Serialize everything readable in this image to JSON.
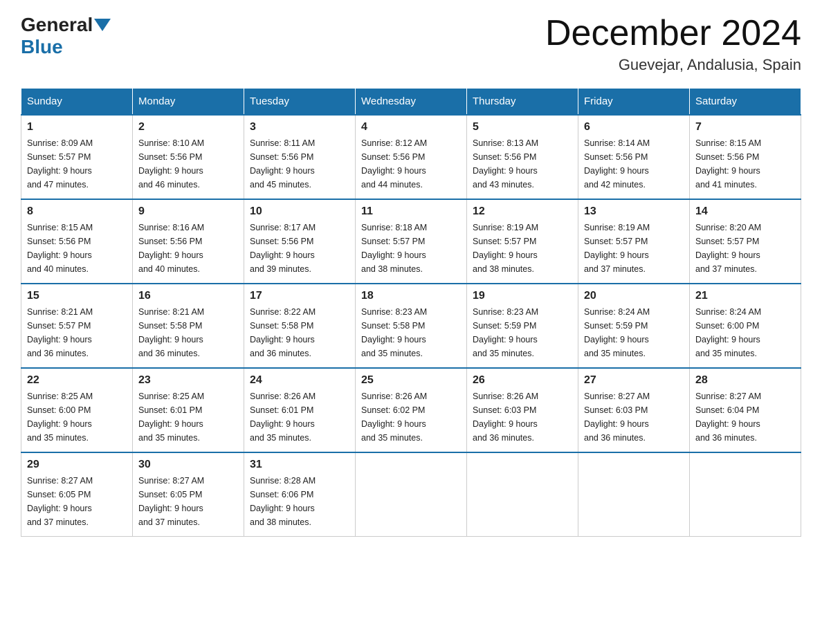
{
  "header": {
    "logo_general": "General",
    "logo_blue": "Blue",
    "month_title": "December 2024",
    "location": "Guevejar, Andalusia, Spain"
  },
  "days_of_week": [
    "Sunday",
    "Monday",
    "Tuesday",
    "Wednesday",
    "Thursday",
    "Friday",
    "Saturday"
  ],
  "weeks": [
    [
      {
        "day": "1",
        "sunrise": "8:09 AM",
        "sunset": "5:57 PM",
        "daylight": "9 hours and 47 minutes."
      },
      {
        "day": "2",
        "sunrise": "8:10 AM",
        "sunset": "5:56 PM",
        "daylight": "9 hours and 46 minutes."
      },
      {
        "day": "3",
        "sunrise": "8:11 AM",
        "sunset": "5:56 PM",
        "daylight": "9 hours and 45 minutes."
      },
      {
        "day": "4",
        "sunrise": "8:12 AM",
        "sunset": "5:56 PM",
        "daylight": "9 hours and 44 minutes."
      },
      {
        "day": "5",
        "sunrise": "8:13 AM",
        "sunset": "5:56 PM",
        "daylight": "9 hours and 43 minutes."
      },
      {
        "day": "6",
        "sunrise": "8:14 AM",
        "sunset": "5:56 PM",
        "daylight": "9 hours and 42 minutes."
      },
      {
        "day": "7",
        "sunrise": "8:15 AM",
        "sunset": "5:56 PM",
        "daylight": "9 hours and 41 minutes."
      }
    ],
    [
      {
        "day": "8",
        "sunrise": "8:15 AM",
        "sunset": "5:56 PM",
        "daylight": "9 hours and 40 minutes."
      },
      {
        "day": "9",
        "sunrise": "8:16 AM",
        "sunset": "5:56 PM",
        "daylight": "9 hours and 40 minutes."
      },
      {
        "day": "10",
        "sunrise": "8:17 AM",
        "sunset": "5:56 PM",
        "daylight": "9 hours and 39 minutes."
      },
      {
        "day": "11",
        "sunrise": "8:18 AM",
        "sunset": "5:57 PM",
        "daylight": "9 hours and 38 minutes."
      },
      {
        "day": "12",
        "sunrise": "8:19 AM",
        "sunset": "5:57 PM",
        "daylight": "9 hours and 38 minutes."
      },
      {
        "day": "13",
        "sunrise": "8:19 AM",
        "sunset": "5:57 PM",
        "daylight": "9 hours and 37 minutes."
      },
      {
        "day": "14",
        "sunrise": "8:20 AM",
        "sunset": "5:57 PM",
        "daylight": "9 hours and 37 minutes."
      }
    ],
    [
      {
        "day": "15",
        "sunrise": "8:21 AM",
        "sunset": "5:57 PM",
        "daylight": "9 hours and 36 minutes."
      },
      {
        "day": "16",
        "sunrise": "8:21 AM",
        "sunset": "5:58 PM",
        "daylight": "9 hours and 36 minutes."
      },
      {
        "day": "17",
        "sunrise": "8:22 AM",
        "sunset": "5:58 PM",
        "daylight": "9 hours and 36 minutes."
      },
      {
        "day": "18",
        "sunrise": "8:23 AM",
        "sunset": "5:58 PM",
        "daylight": "9 hours and 35 minutes."
      },
      {
        "day": "19",
        "sunrise": "8:23 AM",
        "sunset": "5:59 PM",
        "daylight": "9 hours and 35 minutes."
      },
      {
        "day": "20",
        "sunrise": "8:24 AM",
        "sunset": "5:59 PM",
        "daylight": "9 hours and 35 minutes."
      },
      {
        "day": "21",
        "sunrise": "8:24 AM",
        "sunset": "6:00 PM",
        "daylight": "9 hours and 35 minutes."
      }
    ],
    [
      {
        "day": "22",
        "sunrise": "8:25 AM",
        "sunset": "6:00 PM",
        "daylight": "9 hours and 35 minutes."
      },
      {
        "day": "23",
        "sunrise": "8:25 AM",
        "sunset": "6:01 PM",
        "daylight": "9 hours and 35 minutes."
      },
      {
        "day": "24",
        "sunrise": "8:26 AM",
        "sunset": "6:01 PM",
        "daylight": "9 hours and 35 minutes."
      },
      {
        "day": "25",
        "sunrise": "8:26 AM",
        "sunset": "6:02 PM",
        "daylight": "9 hours and 35 minutes."
      },
      {
        "day": "26",
        "sunrise": "8:26 AM",
        "sunset": "6:03 PM",
        "daylight": "9 hours and 36 minutes."
      },
      {
        "day": "27",
        "sunrise": "8:27 AM",
        "sunset": "6:03 PM",
        "daylight": "9 hours and 36 minutes."
      },
      {
        "day": "28",
        "sunrise": "8:27 AM",
        "sunset": "6:04 PM",
        "daylight": "9 hours and 36 minutes."
      }
    ],
    [
      {
        "day": "29",
        "sunrise": "8:27 AM",
        "sunset": "6:05 PM",
        "daylight": "9 hours and 37 minutes."
      },
      {
        "day": "30",
        "sunrise": "8:27 AM",
        "sunset": "6:05 PM",
        "daylight": "9 hours and 37 minutes."
      },
      {
        "day": "31",
        "sunrise": "8:28 AM",
        "sunset": "6:06 PM",
        "daylight": "9 hours and 38 minutes."
      },
      null,
      null,
      null,
      null
    ]
  ],
  "labels": {
    "sunrise": "Sunrise:",
    "sunset": "Sunset:",
    "daylight": "Daylight:"
  }
}
